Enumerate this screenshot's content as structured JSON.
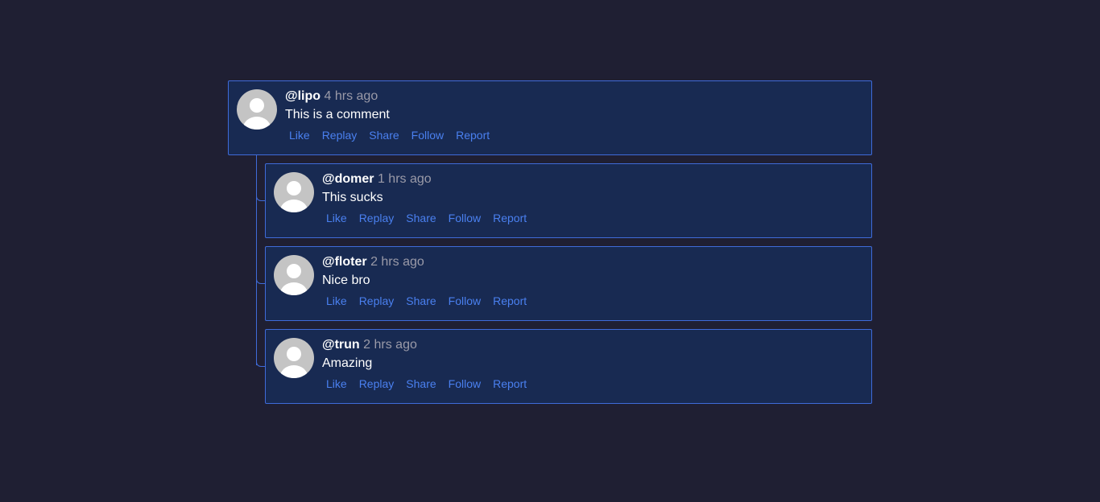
{
  "comments": [
    {
      "username": "@lipo",
      "time": "4 hrs ago",
      "text": "This is a comment",
      "actions": [
        "Like",
        "Replay",
        "Share",
        "Follow",
        "Report"
      ]
    },
    {
      "username": "@domer",
      "time": "1 hrs ago",
      "text": "This sucks",
      "actions": [
        "Like",
        "Replay",
        "Share",
        "Follow",
        "Report"
      ]
    },
    {
      "username": "@floter",
      "time": "2 hrs ago",
      "text": "Nice bro",
      "actions": [
        "Like",
        "Replay",
        "Share",
        "Follow",
        "Report"
      ]
    },
    {
      "username": "@trun",
      "time": "2 hrs ago",
      "text": "Amazing",
      "actions": [
        "Like",
        "Replay",
        "Share",
        "Follow",
        "Report"
      ]
    }
  ],
  "icons": {
    "avatar": "user-silhouette-icon"
  },
  "colors": {
    "background": "#1f1f33",
    "card": "#182a52",
    "border": "#3f6bd9",
    "action": "#4a80f0",
    "time": "#9a9aa8",
    "text": "#ffffff"
  }
}
